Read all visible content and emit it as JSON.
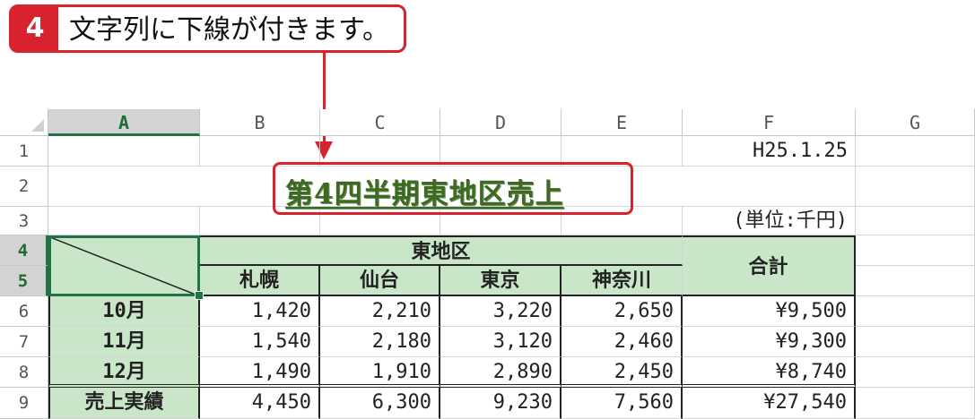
{
  "callout": {
    "step": "4",
    "text": "文字列に下線が付きます。"
  },
  "columns": [
    "A",
    "B",
    "C",
    "D",
    "E",
    "F",
    "G"
  ],
  "rows": [
    "1",
    "2",
    "3",
    "4",
    "5",
    "6",
    "7",
    "8",
    "9"
  ],
  "cells": {
    "F1": "H25.1.25",
    "title": "第4四半期東地区売上",
    "F3": "(単位:千円)",
    "region": "東地区",
    "total_header": "合計",
    "branches": [
      "札幌",
      "仙台",
      "東京",
      "神奈川"
    ],
    "data_rows": [
      {
        "label": "10月",
        "values": [
          "1,420",
          "2,210",
          "3,220",
          "2,650"
        ],
        "total": "¥9,500"
      },
      {
        "label": "11月",
        "values": [
          "1,540",
          "2,180",
          "3,120",
          "2,460"
        ],
        "total": "¥9,300"
      },
      {
        "label": "12月",
        "values": [
          "1,490",
          "1,910",
          "2,890",
          "2,450"
        ],
        "total": "¥8,740"
      },
      {
        "label": "売上実績",
        "values": [
          "4,450",
          "6,300",
          "9,230",
          "7,560"
        ],
        "total": "¥27,540"
      }
    ]
  },
  "colors": {
    "accent_red": "#d8232f",
    "header_green": "#c9e6c9",
    "excel_green": "#217346"
  }
}
